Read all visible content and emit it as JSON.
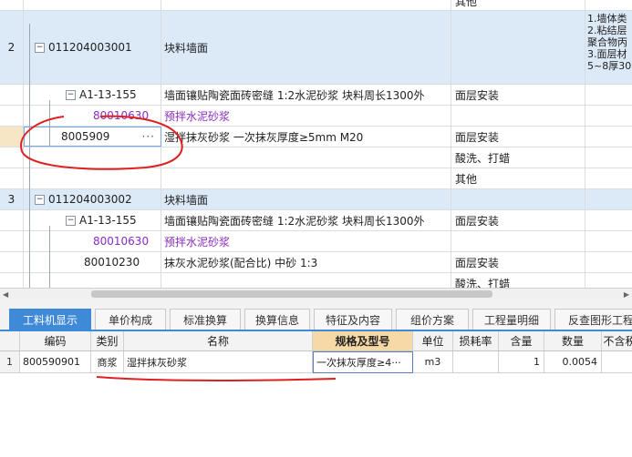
{
  "top_grid": {
    "rows": [
      {
        "kind": "other-top",
        "content": "其他"
      },
      {
        "kind": "list",
        "index": "2",
        "code": "011204003001",
        "name": "块料墙面",
        "features": [
          "1.墙体类",
          "2.粘结层",
          "聚合物丙",
          "3.面层材",
          "5~8厚30"
        ]
      },
      {
        "kind": "quota",
        "code": "A1-13-155",
        "name": "墙面镶贴陶瓷面砖密缝 1:2水泥砂浆 块料周长1300外",
        "content": "面层安装"
      },
      {
        "kind": "material",
        "code": "80010630",
        "name": "预拌水泥砂浆",
        "content": ""
      },
      {
        "kind": "material-edit",
        "code": "8005909",
        "name": "湿拌抹灰砂浆 一次抹灰厚度≥5mm M20",
        "content": "面层安装"
      },
      {
        "kind": "blank",
        "content": "酸洗、打蜡"
      },
      {
        "kind": "blank",
        "content": "其他"
      },
      {
        "kind": "list",
        "index": "3",
        "code": "011204003002",
        "name": "块料墙面",
        "content": ""
      },
      {
        "kind": "quota",
        "code": "A1-13-155",
        "name": "墙面镶贴陶瓷面砖密缝 1:2水泥砂浆 块料周长1300外",
        "content": "面层安装"
      },
      {
        "kind": "material",
        "code": "80010630",
        "name": "预拌水泥砂浆",
        "content": ""
      },
      {
        "kind": "material2",
        "code": "80010230",
        "name": "抹灰水泥砂浆(配合比) 中砂 1:3",
        "content": "面层安装"
      },
      {
        "kind": "blank",
        "content": "酸洗、打蜡"
      }
    ],
    "edit_button": "···"
  },
  "tabs": [
    "工料机显示",
    "单价构成",
    "标准换算",
    "换算信息",
    "特征及内容",
    "组价方案",
    "工程量明细",
    "反查图形工程"
  ],
  "bottom_table": {
    "headers": [
      "编码",
      "类别",
      "名称",
      "规格及型号",
      "单位",
      "损耗率",
      "含量",
      "数量",
      "不含税"
    ],
    "row": {
      "index": "1",
      "code": "800590901",
      "category": "商浆",
      "name": "湿拌抹灰砂浆",
      "spec": "一次抹灰厚度≥4···",
      "unit": "m3",
      "loss": "",
      "content_qty": "1",
      "quantity": "0.0054",
      "notax": ""
    }
  },
  "colors": {
    "accent": "#3f8ad6",
    "selected_row": "#dce9f7",
    "material_text": "#8a2bbd",
    "annotation": "#e02020"
  }
}
